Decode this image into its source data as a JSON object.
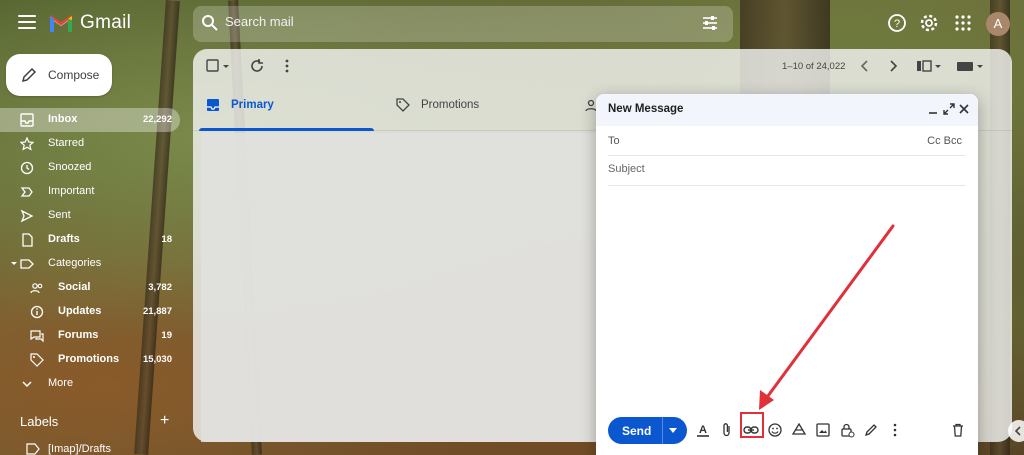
{
  "app": {
    "name": "Gmail",
    "avatar_initial": "A"
  },
  "search": {
    "placeholder": "Search mail"
  },
  "compose": {
    "label": "Compose"
  },
  "sidebar": {
    "items": [
      {
        "label": "Inbox",
        "count": "22,292",
        "icon": "inbox-icon"
      },
      {
        "label": "Starred",
        "count": "",
        "icon": "star-icon"
      },
      {
        "label": "Snoozed",
        "count": "",
        "icon": "clock-icon"
      },
      {
        "label": "Important",
        "count": "",
        "icon": "important-icon"
      },
      {
        "label": "Sent",
        "count": "",
        "icon": "send-icon"
      },
      {
        "label": "Drafts",
        "count": "18",
        "icon": "draft-icon"
      },
      {
        "label": "Categories",
        "count": "",
        "icon": "label-icon"
      },
      {
        "label": "Social",
        "count": "3,782",
        "icon": "people-icon"
      },
      {
        "label": "Updates",
        "count": "21,887",
        "icon": "info-icon"
      },
      {
        "label": "Forums",
        "count": "19",
        "icon": "forum-icon"
      },
      {
        "label": "Promotions",
        "count": "15,030",
        "icon": "tag-icon"
      },
      {
        "label": "More",
        "count": "",
        "icon": "chevron-down-icon"
      }
    ],
    "labels_heading": "Labels",
    "labels_items": [
      {
        "label": "[Imap]/Drafts"
      }
    ]
  },
  "toolbar": {
    "pagination": "1–10 of 24,022"
  },
  "tabs": [
    {
      "label": "Primary"
    },
    {
      "label": "Promotions"
    }
  ],
  "compose_dialog": {
    "title": "New Message",
    "to_label": "To",
    "cc_bcc": "Cc Bcc",
    "subject_placeholder": "Subject",
    "send_label": "Send"
  },
  "colors": {
    "accent": "#0b57d0",
    "highlight": "#e0303a"
  }
}
